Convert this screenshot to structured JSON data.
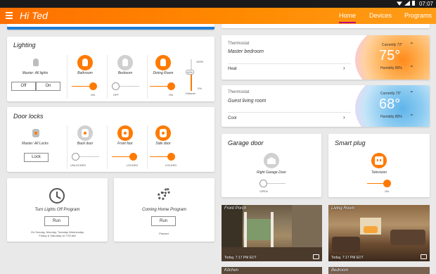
{
  "status": {
    "time": "07:07"
  },
  "app": {
    "title": "Hi Ted",
    "tabs": {
      "home": "Home",
      "devices": "Devices",
      "programs": "Programs"
    }
  },
  "lighting": {
    "title": "Lighting",
    "master_label": "Master: All lights",
    "off_label": "Off",
    "on_label": "On",
    "devices": [
      {
        "name": "Bathroom",
        "state": "ON"
      },
      {
        "name": "Bedroom",
        "state": "OFF"
      },
      {
        "name": "Dining Room",
        "state": "ON"
      }
    ],
    "dimmer": {
      "top": "100%",
      "value": "60%",
      "bottom": "0%",
      "label": "Dimmer",
      "level": 0.6
    }
  },
  "doorlocks": {
    "title": "Door locks",
    "master_label": "Master: All Locks",
    "lock_label": "Lock",
    "devices": [
      {
        "name": "Back door",
        "state": "UNLOCKED"
      },
      {
        "name": "Front foor",
        "state": "LOCKED"
      },
      {
        "name": "Side door",
        "state": "LOCKED"
      }
    ]
  },
  "programs": [
    {
      "title": "Turn Lights Off Program",
      "run": "Run",
      "schedule_line1": "On Sunday, Monday, Tuesday Wednesday",
      "schedule_line2": "Friday & Saturday at 7:00 AM"
    },
    {
      "title": "Coming Home Program",
      "run": "Run",
      "status": "Paused"
    }
  ],
  "thermostats": [
    {
      "label": "Thermostat",
      "name": "Master bedroom",
      "mode": "Heat",
      "currently": "Currently 72°",
      "temp": "75°",
      "humidity": "Humidity 80%",
      "accent": "#ff8a1a"
    },
    {
      "label": "Thermostat",
      "name": "Guest living room",
      "mode": "Cool",
      "currently": "Currently 73°",
      "temp": "68°",
      "humidity": "Humidity 80%",
      "accent": "#5fb4ea"
    }
  ],
  "garage": {
    "title": "Garage door",
    "device": "Right Garage Door",
    "state": "OPEN"
  },
  "smartplug": {
    "title": "Smart plug",
    "device": "Television",
    "state": "ON"
  },
  "cameras": [
    {
      "name": "Front Porch",
      "date": "Today, 7:17 PM EDT"
    },
    {
      "name": "Living Room",
      "date": "Today, 7:17 PM EDT"
    },
    {
      "name": "Kitchen",
      "date": ""
    },
    {
      "name": "Bedroom",
      "date": ""
    }
  ],
  "colors": {
    "accent": "#ff7a00",
    "appbar": "#ff8a00",
    "tab_indicator": "#c0007a"
  }
}
